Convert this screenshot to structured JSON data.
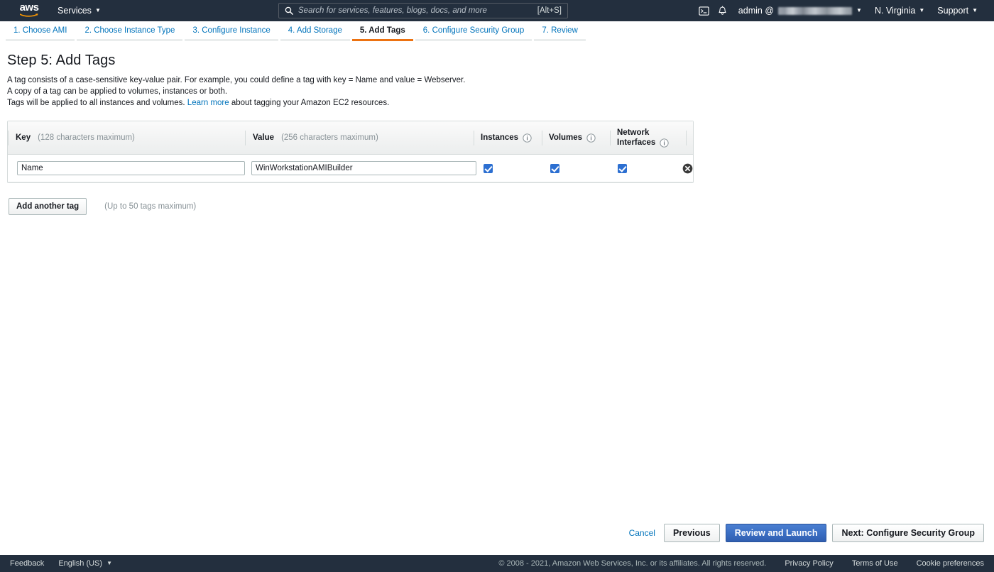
{
  "top_nav": {
    "logo_text": "aws",
    "services_label": "Services",
    "search": {
      "placeholder": "Search for services, features, blogs, docs, and more",
      "value": "",
      "shortcut": "[Alt+S]",
      "icon": "search-icon"
    },
    "cloudshell_icon": "cloudshell-terminal-icon",
    "notifications_icon": "bell-icon",
    "account_label": "admin @",
    "account_id_redacted": true,
    "region_label": "N. Virginia",
    "support_label": "Support",
    "caret": "▼",
    "colors": {
      "background": "#232f3e",
      "logo_swoosh": "#ff9900",
      "text": "#ffffff"
    }
  },
  "wizard": {
    "tabs": [
      {
        "label": "1. Choose AMI",
        "active": false
      },
      {
        "label": "2. Choose Instance Type",
        "active": false
      },
      {
        "label": "3. Configure Instance",
        "active": false
      },
      {
        "label": "4. Add Storage",
        "active": false
      },
      {
        "label": "5. Add Tags",
        "active": true
      },
      {
        "label": "6. Configure Security Group",
        "active": false
      },
      {
        "label": "7. Review",
        "active": false
      }
    ],
    "active_accent": "#ec7211",
    "link_color": "#0073bb"
  },
  "page": {
    "title": "Step 5: Add Tags",
    "desc_line_1": "A tag consists of a case-sensitive key-value pair. For example, you could define a tag with key = Name and value = Webserver.",
    "desc_line_2": "A copy of a tag can be applied to volumes, instances or both.",
    "desc_line_3_pre": "Tags will be applied to all instances and volumes.",
    "desc_line_3_link": "Learn more",
    "desc_line_3_post": "about tagging your Amazon EC2 resources."
  },
  "tag_table": {
    "headers": {
      "key_label": "Key",
      "key_hint": "(128 characters maximum)",
      "value_label": "Value",
      "value_hint": "(256 characters maximum)",
      "instances_label": "Instances",
      "volumes_label": "Volumes",
      "network_interfaces_label_line1": "Network",
      "network_interfaces_label_line2": "Interfaces",
      "info_icon": "info-circle-icon"
    },
    "rows": [
      {
        "key": "Name",
        "value": "WinWorkstationAMIBuilder",
        "instances_checked": true,
        "volumes_checked": true,
        "network_interfaces_checked": true,
        "remove_icon": "remove-circle-x-icon"
      }
    ],
    "add_another_tag_label": "Add another tag",
    "tag_limit_hint": "(Up to 50 tags maximum)",
    "checkbox_color": "#2c6fd1"
  },
  "action_bar": {
    "cancel_label": "Cancel",
    "previous_label": "Previous",
    "review_and_launch_label": "Review and Launch",
    "next_label": "Next: Configure Security Group",
    "primary_color": "#3c6fc4"
  },
  "footer": {
    "feedback_label": "Feedback",
    "language_label": "English (US)",
    "copyright": "© 2008 - 2021, Amazon Web Services, Inc. or its affiliates. All rights reserved.",
    "privacy_policy_label": "Privacy Policy",
    "terms_of_use_label": "Terms of Use",
    "cookie_preferences_label": "Cookie preferences",
    "caret": "▼"
  }
}
